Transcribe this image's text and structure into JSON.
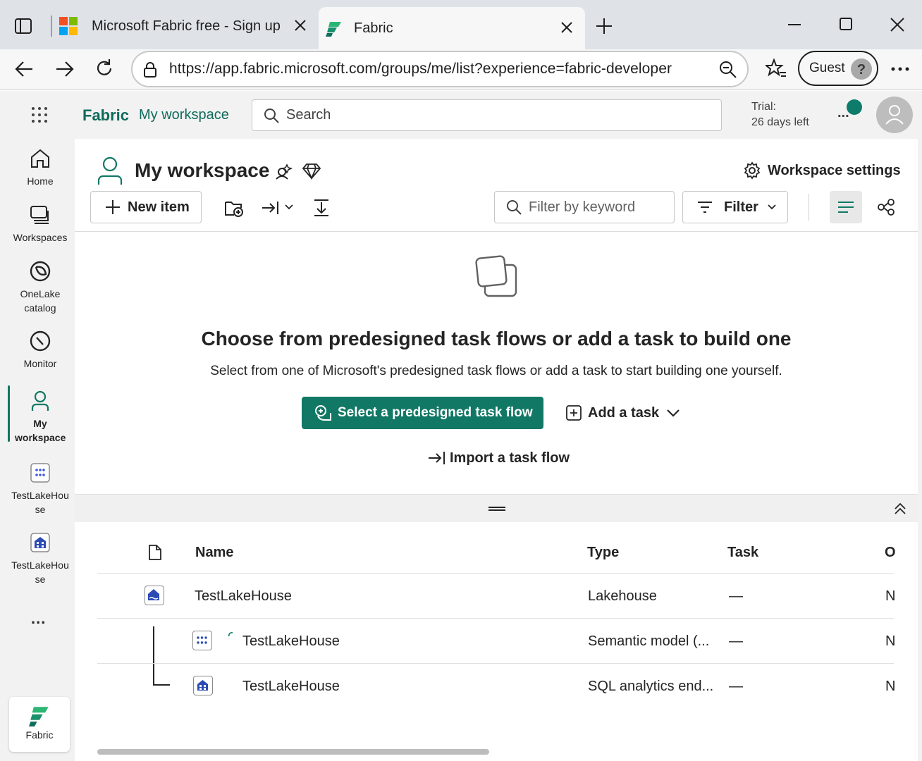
{
  "browser": {
    "tabs": [
      {
        "title": "Microsoft Fabric free - Sign up"
      },
      {
        "title": "Fabric"
      }
    ],
    "url": "https://app.fabric.microsoft.com/groups/me/list?experience=fabric-developer",
    "profile_label": "Guest"
  },
  "header": {
    "brand": "Fabric",
    "breadcrumb": "My workspace",
    "search_placeholder": "Search",
    "trial_line1": "Trial:",
    "trial_line2": "26 days left",
    "more": "..."
  },
  "rail": {
    "items": [
      {
        "label": "Home"
      },
      {
        "label": "Workspaces"
      },
      {
        "label": "OneLake catalog"
      },
      {
        "label": "Monitor"
      },
      {
        "label": "My workspace"
      },
      {
        "label": "TestLakeHouse"
      },
      {
        "label": "TestLakeHouse"
      }
    ],
    "more": "...",
    "bottom_label": "Fabric"
  },
  "workspace": {
    "title": "My workspace",
    "settings_label": "Workspace settings",
    "new_item_label": "New item",
    "filter_placeholder": "Filter by keyword",
    "filter_label": "Filter"
  },
  "taskflow": {
    "heading": "Choose from predesigned task flows or add a task to build one",
    "subtext": "Select from one of Microsoft's predesigned task flows or add a task to start building one yourself.",
    "primary_button": "Select a predesigned task flow",
    "add_task": "Add a task",
    "import": "Import a task flow"
  },
  "table": {
    "headers": {
      "name": "Name",
      "type": "Type",
      "task": "Task",
      "owner": "O"
    },
    "rows": [
      {
        "name": "TestLakeHouse",
        "type": "Lakehouse",
        "task": "—",
        "owner": "N"
      },
      {
        "name": "TestLakeHouse",
        "type": "Semantic model (...",
        "task": "—",
        "owner": "N"
      },
      {
        "name": "TestLakeHouse",
        "type": "SQL analytics end...",
        "task": "—",
        "owner": "N"
      }
    ]
  },
  "colors": {
    "accent": "#117865",
    "brand_text": "#0f6b5c",
    "presence": "#0e7c6b"
  }
}
